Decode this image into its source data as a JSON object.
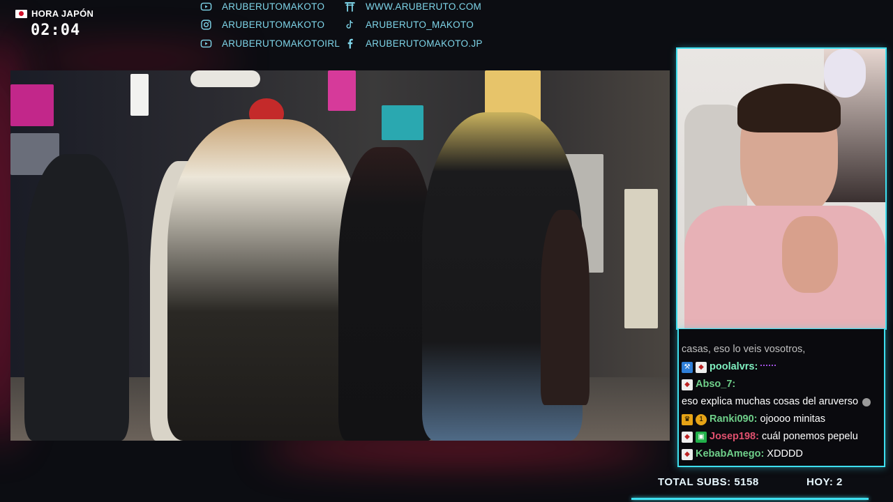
{
  "clock": {
    "label": "HORA JAPÓN",
    "time": "02:04"
  },
  "socials": {
    "left": [
      {
        "icon": "youtube-icon",
        "text": "ARUBERUTOMAKOTO"
      },
      {
        "icon": "instagram-icon",
        "text": "ARUBERUTOMAKOTO"
      },
      {
        "icon": "youtube-icon",
        "text": "ARUBERUTOMAKOTOIRL"
      }
    ],
    "right": [
      {
        "icon": "shrine-gate-icon",
        "text": "WWW.ARUBERUTO.COM"
      },
      {
        "icon": "tiktok-icon",
        "text": "ARUBERUTO_MAKOTO"
      },
      {
        "icon": "facebook-icon",
        "text": "ARUBERUTOMAKOTO.JP"
      }
    ]
  },
  "chat": {
    "partial": "casas, eso lo veis vosotros,",
    "messages": [
      {
        "user": "poolalvrs:",
        "color": "#7ff0c0",
        "text": "",
        "badges": [
          "tool-badge-icon",
          "fox-mask-icon"
        ]
      },
      {
        "user": "Abso_7:",
        "color": "#6fd08a",
        "text": "eso explica muchas cosas del aruverso",
        "badges": [
          "fox-mask-icon"
        ]
      },
      {
        "user": "Ranki090:",
        "color": "#6fd08a",
        "text": "ojoooo minitas",
        "badges": [
          "crown-icon",
          "coin-icon"
        ]
      },
      {
        "user": "Josep198:",
        "color": "#e0506e",
        "text": "cuál ponemos pepelu",
        "badges": [
          "fox-mask-icon",
          "gift-icon"
        ]
      },
      {
        "user": "KebabAmego:",
        "color": "#6fd08a",
        "text": "XDDDD",
        "badges": [
          "fox-mask-icon"
        ]
      }
    ]
  },
  "stats": {
    "total_label": "TOTAL SUBS: 5158",
    "today_label": "HOY: 2"
  },
  "colors": {
    "accent": "#3ee0f0",
    "social_text": "#7fd6ea"
  }
}
